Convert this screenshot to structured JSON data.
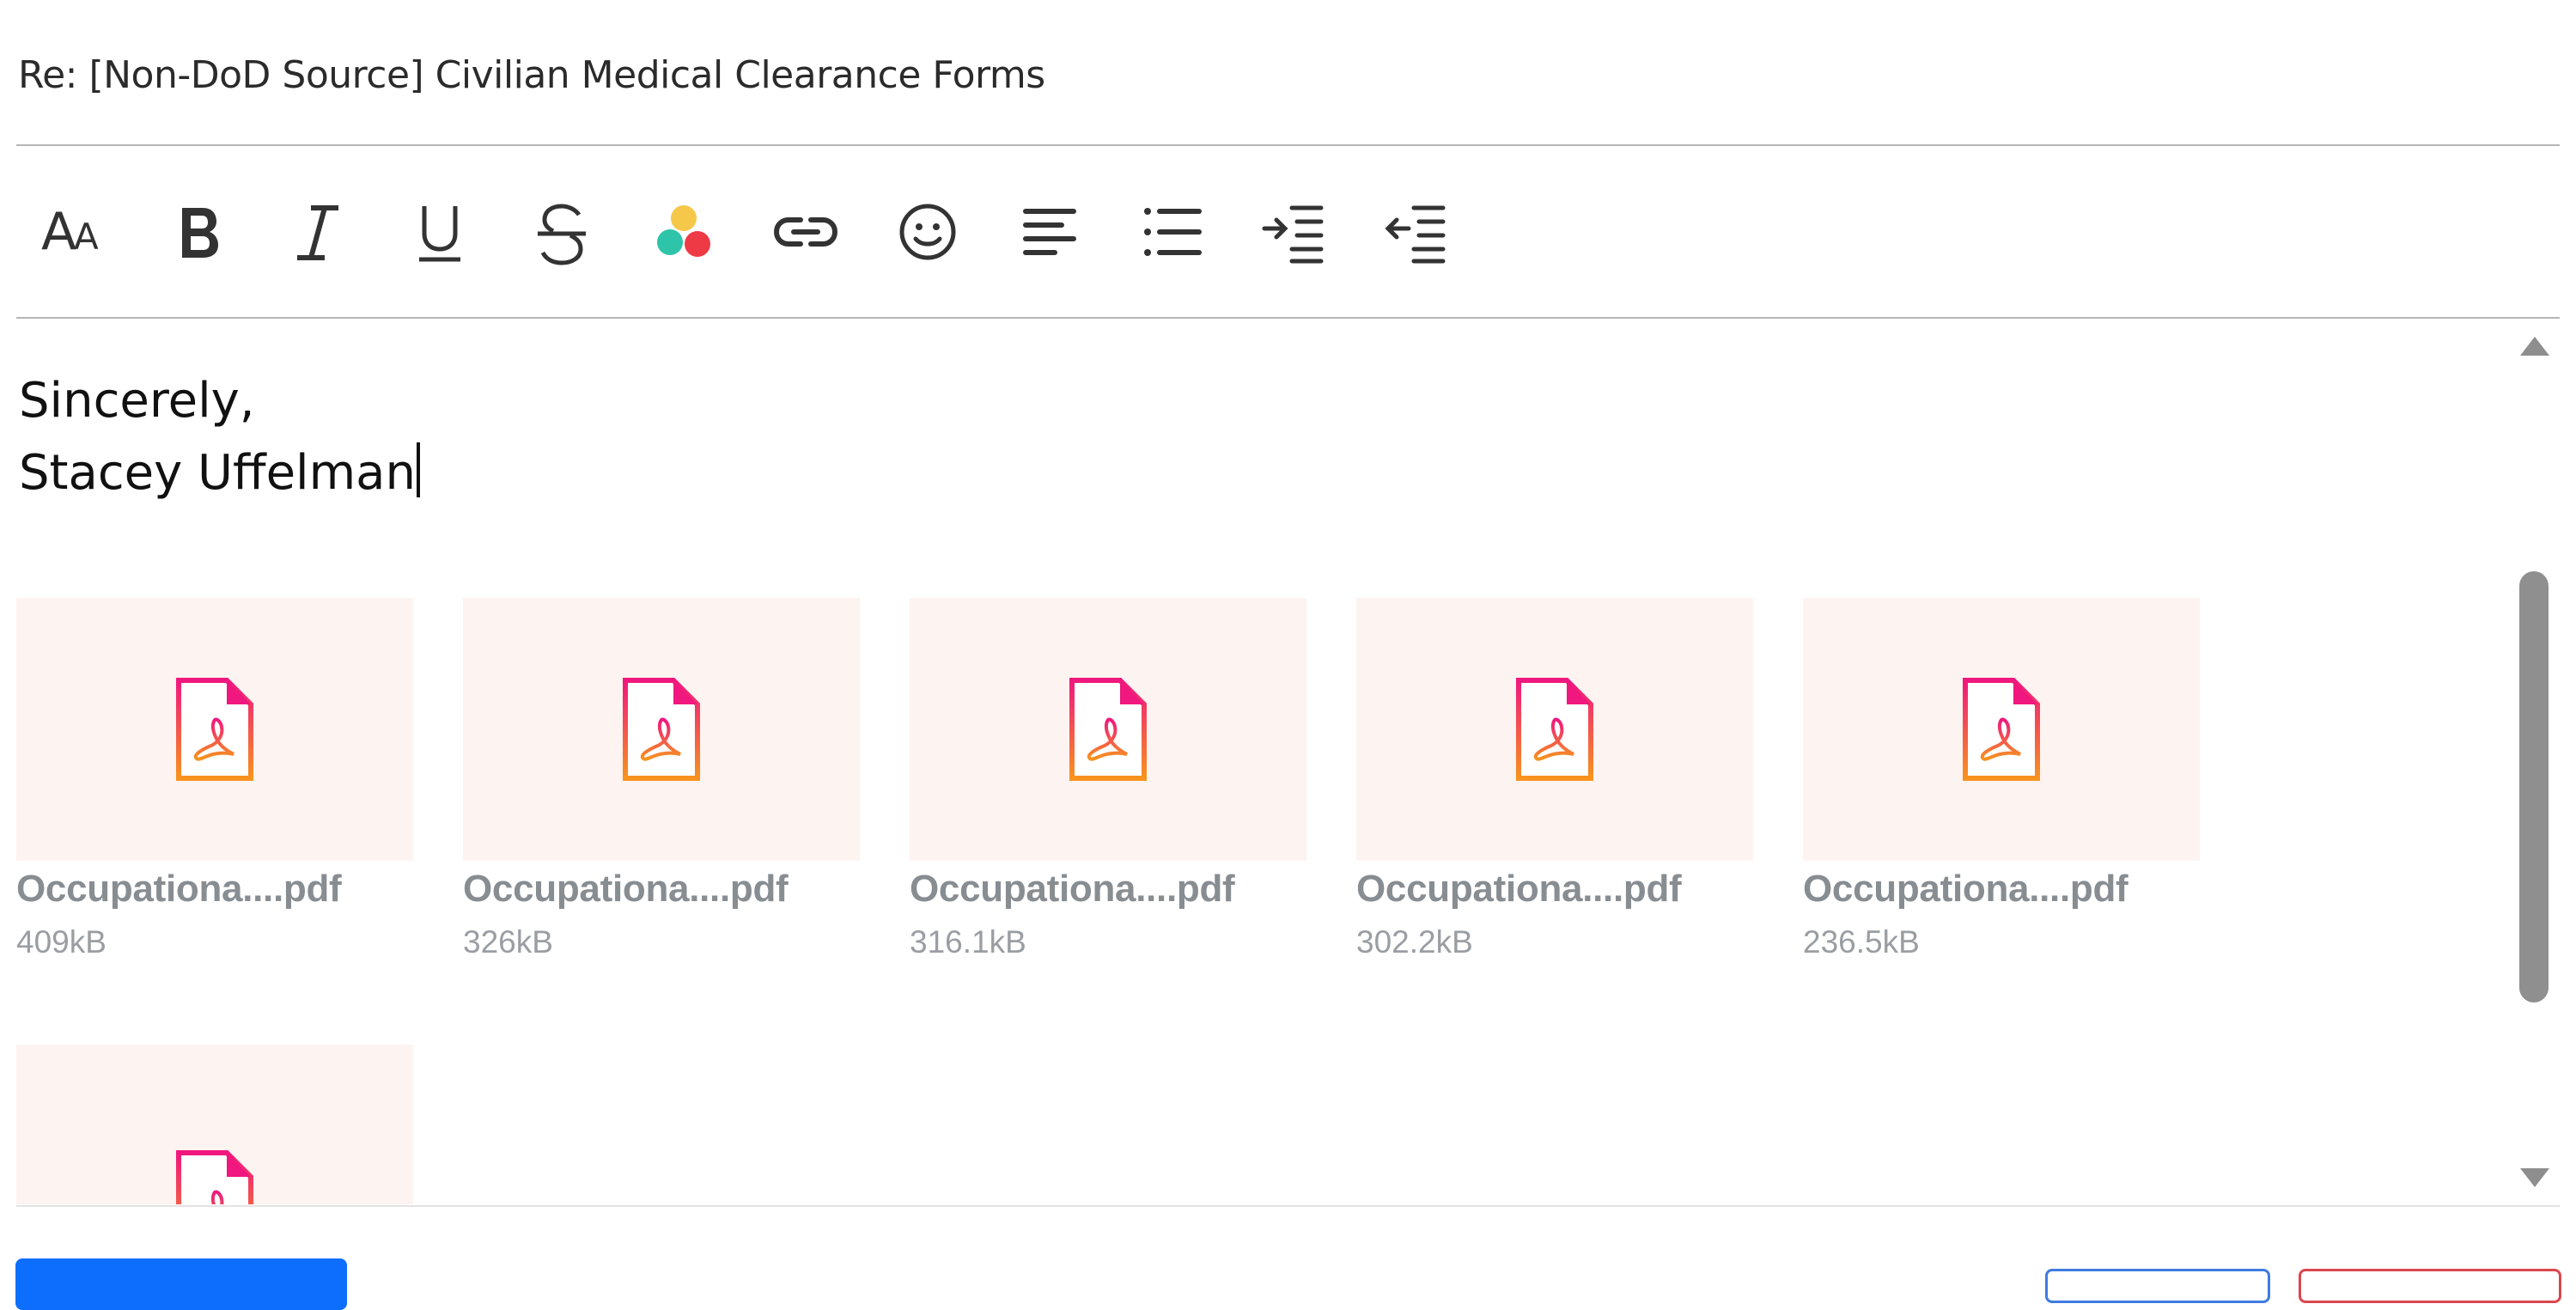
{
  "compose": {
    "subject": "Re: [Non-DoD Source] Civilian Medical Clearance Forms"
  },
  "toolbar": {
    "items": [
      {
        "name": "font-size-icon",
        "label": "Font size"
      },
      {
        "name": "bold-icon",
        "label": "Bold"
      },
      {
        "name": "italic-icon",
        "label": "Italic"
      },
      {
        "name": "underline-icon",
        "label": "Underline"
      },
      {
        "name": "strikethrough-icon",
        "label": "Strikethrough"
      },
      {
        "name": "text-color-icon",
        "label": "Text color"
      },
      {
        "name": "link-icon",
        "label": "Insert link"
      },
      {
        "name": "emoji-icon",
        "label": "Emoji"
      },
      {
        "name": "align-left-icon",
        "label": "Align"
      },
      {
        "name": "bulleted-list-icon",
        "label": "Bulleted list"
      },
      {
        "name": "indent-icon",
        "label": "Indent"
      },
      {
        "name": "outdent-icon",
        "label": "Outdent"
      }
    ],
    "colors": {
      "dot_yellow": "#f6c84a",
      "dot_teal": "#2ec4a9",
      "dot_red": "#ee3a45"
    }
  },
  "message": {
    "lines": [
      "Sincerely,",
      "Stacey Uffelman"
    ]
  },
  "attachments": [
    {
      "name": "Occupationa....pdf",
      "size": "409kB"
    },
    {
      "name": "Occupationa....pdf",
      "size": "326kB"
    },
    {
      "name": "Occupationa....pdf",
      "size": "316.1kB"
    },
    {
      "name": "Occupationa....pdf",
      "size": "302.2kB"
    },
    {
      "name": "Occupationa....pdf",
      "size": "236.5kB"
    },
    {
      "name": "",
      "size": ""
    }
  ],
  "colors": {
    "pdf_gradient_top": "#f0177e",
    "pdf_gradient_bottom": "#f7931e",
    "thumb_bg": "#fdf3f1",
    "primary_button": "#0d6efd"
  }
}
